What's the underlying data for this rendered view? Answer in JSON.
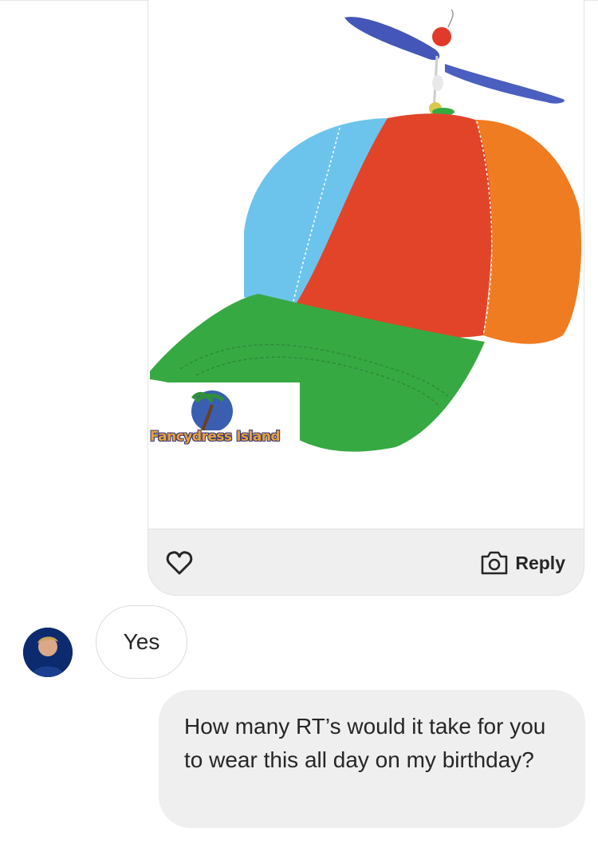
{
  "shared_post": {
    "image_alt": "Rainbow propeller beanie cap",
    "watermark": "Fancydress Island",
    "actions": {
      "reply_label": "Reply"
    }
  },
  "messages": [
    {
      "from": "other",
      "text": "Yes"
    },
    {
      "from": "me",
      "text": "How many RT’s would it take for you to wear this all day on my birthday?"
    }
  ],
  "colors": {
    "bubble_gray": "#efefef",
    "text": "#262626",
    "border": "#dbdbdb",
    "cap_blue": "#6cc4ec",
    "cap_red": "#e2442a",
    "cap_orange": "#f07c22",
    "cap_green": "#37a943",
    "propeller": "#4a5fbf"
  },
  "icons": [
    "heart-icon",
    "camera-icon"
  ]
}
